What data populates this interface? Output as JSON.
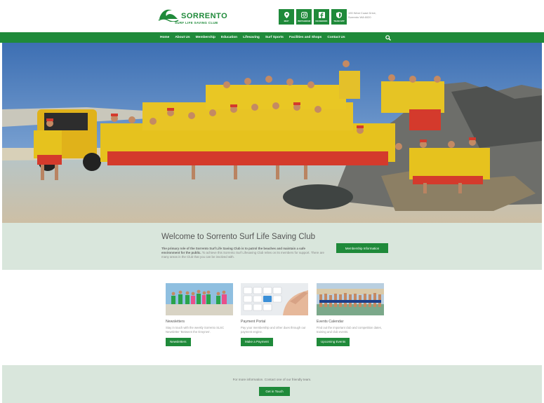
{
  "header": {
    "logo_name": "SORRENTO",
    "logo_subtitle": "SURF LIFE SAVING CLUB",
    "quick_links": [
      {
        "label": "MAP",
        "icon": "map-pin-icon"
      },
      {
        "label": "INSTAGRAM",
        "icon": "instagram-icon"
      },
      {
        "label": "FACEBOOK",
        "icon": "facebook-icon"
      },
      {
        "label": "TEAM APP",
        "icon": "shield-icon"
      }
    ],
    "address_line1": "190 West Coast Drive,",
    "address_line2": "Sorrento WA 6020"
  },
  "nav": {
    "items": [
      "Home",
      "About Us",
      "Membership",
      "Education",
      "Lifesaving",
      "Surf Sports",
      "Facilities and Shops",
      "Contact Us"
    ],
    "search_icon": "search-icon"
  },
  "welcome": {
    "title": "Welcome to Sorrento Surf Life Saving Club",
    "intro_bold": "The primary role of the Sorrento Surf Life Saving Club is to patrol the beaches and maintain a safe environment for the public.",
    "intro_rest": " To achieve this Sorrento Surf Lifesaving Club relies on its members for support. There are many areas in the Club that you can be involved with.",
    "button": "Membership Information"
  },
  "cards": [
    {
      "title": "Newsletters",
      "text": "Stay in touch with the weekly Sorrento SLSC Newsletter 'Between the Groynes'.",
      "button": "Newsletters"
    },
    {
      "title": "Payment Portal",
      "text": "Pay your membership and other dues through our payment engine.",
      "button": "Make a Payment"
    },
    {
      "title": "Events Calendar",
      "text": "Find out the important club and competition dates, training and club events.",
      "button": "Upcoming Events"
    }
  ],
  "footer": {
    "text": "For more information. Contact one of our friendly team.",
    "button": "Get in Touch"
  },
  "colors": {
    "brand_green": "#1f8a3a",
    "band_background": "#d9e6dc"
  }
}
